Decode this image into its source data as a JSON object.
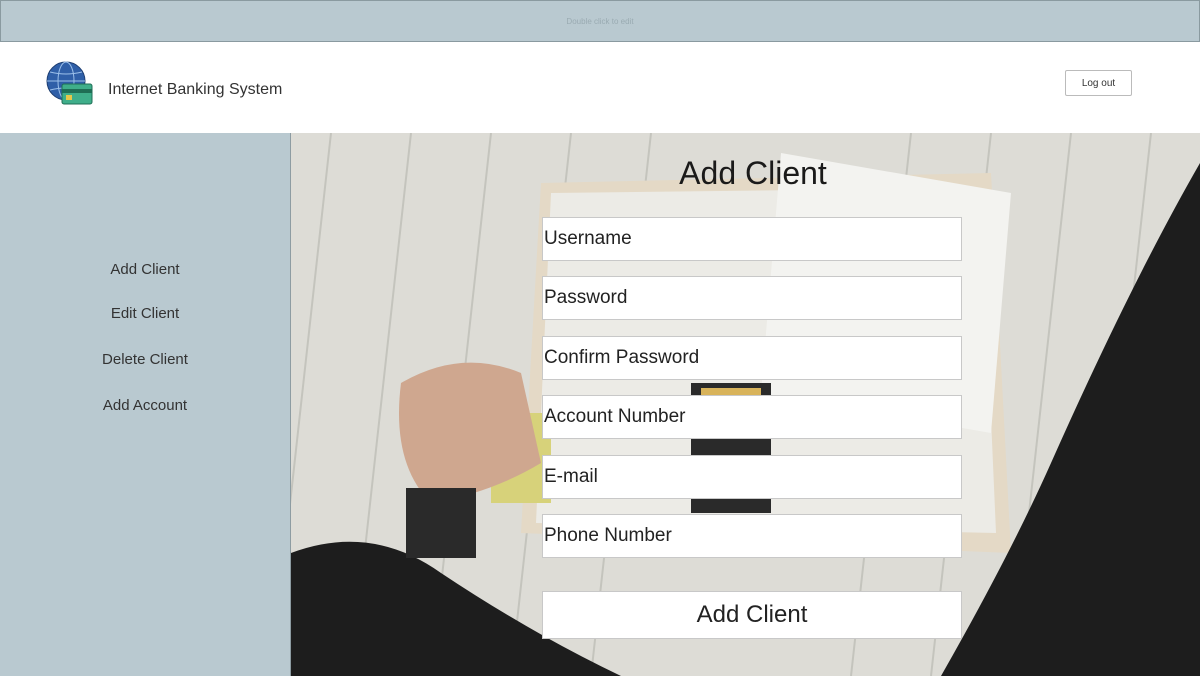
{
  "topbar": {
    "hint": "Double click to edit"
  },
  "header": {
    "app_title": "Internet Banking System",
    "logout_label": "Log out"
  },
  "sidebar": {
    "items": [
      {
        "label": "Add Client"
      },
      {
        "label": "Edit Client"
      },
      {
        "label": "Delete Client"
      },
      {
        "label": "Add Account"
      }
    ]
  },
  "form": {
    "title": "Add Client",
    "fields": [
      {
        "placeholder": "Username"
      },
      {
        "placeholder": "Password"
      },
      {
        "placeholder": "Confirm Password"
      },
      {
        "placeholder": "Account Number"
      },
      {
        "placeholder": "E-mail"
      },
      {
        "placeholder": "Phone Number"
      }
    ],
    "submit_label": "Add Client"
  },
  "colors": {
    "panel": "#b9c9d0",
    "header_bg": "#ffffff",
    "field_bg": "#ffffff"
  }
}
